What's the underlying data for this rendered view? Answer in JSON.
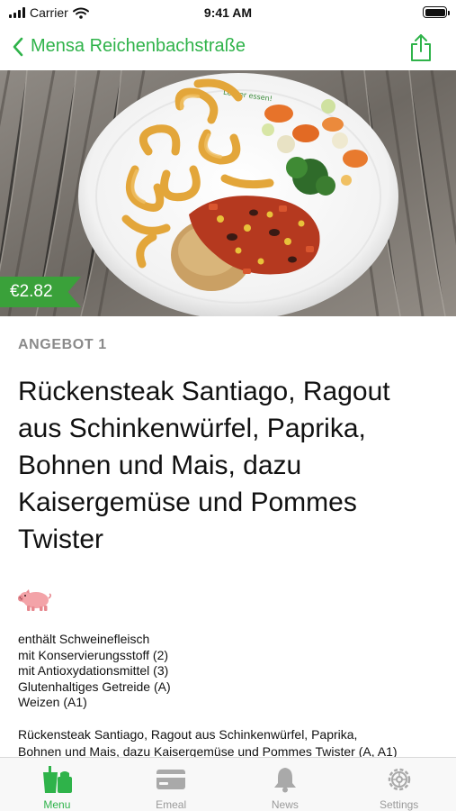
{
  "status_bar": {
    "carrier": "Carrier",
    "time": "9:41 AM"
  },
  "nav": {
    "title": "Mensa Reichenbachstraße",
    "accent_color": "#2fb34a"
  },
  "hero": {
    "price": "€2.82",
    "price_badge_color": "#3aa13a",
    "plate_text": "Lecker essen!"
  },
  "dish": {
    "offer_label": "ANGEBOT 1",
    "title_lines": [
      "Rückensteak Santiago, Ragout",
      "aus Schinkenwürfel, Paprika,",
      "Bohnen und Mais, dazu",
      "Kaisergemüse und Pommes",
      "Twister"
    ],
    "diet_icon": "pig-icon",
    "info": [
      "enthält Schweinefleisch",
      "mit Konservierungsstoff (2)",
      "mit Antioxydationsmittel (3)",
      "Glutenhaltiges Getreide (A)",
      "Weizen (A1)"
    ],
    "description_lines": [
      "Rückensteak Santiago, Ragout aus Schinkenwürfel, Paprika,",
      "Bohnen und Mais, dazu Kaisergemüse und Pommes Twister (A, A1)"
    ]
  },
  "tabs": [
    {
      "label": "Menu",
      "icon": "menu-icon",
      "active": true
    },
    {
      "label": "Emeal",
      "icon": "card-icon",
      "active": false
    },
    {
      "label": "News",
      "icon": "bell-icon",
      "active": false
    },
    {
      "label": "Settings",
      "icon": "gear-icon",
      "active": false
    }
  ]
}
